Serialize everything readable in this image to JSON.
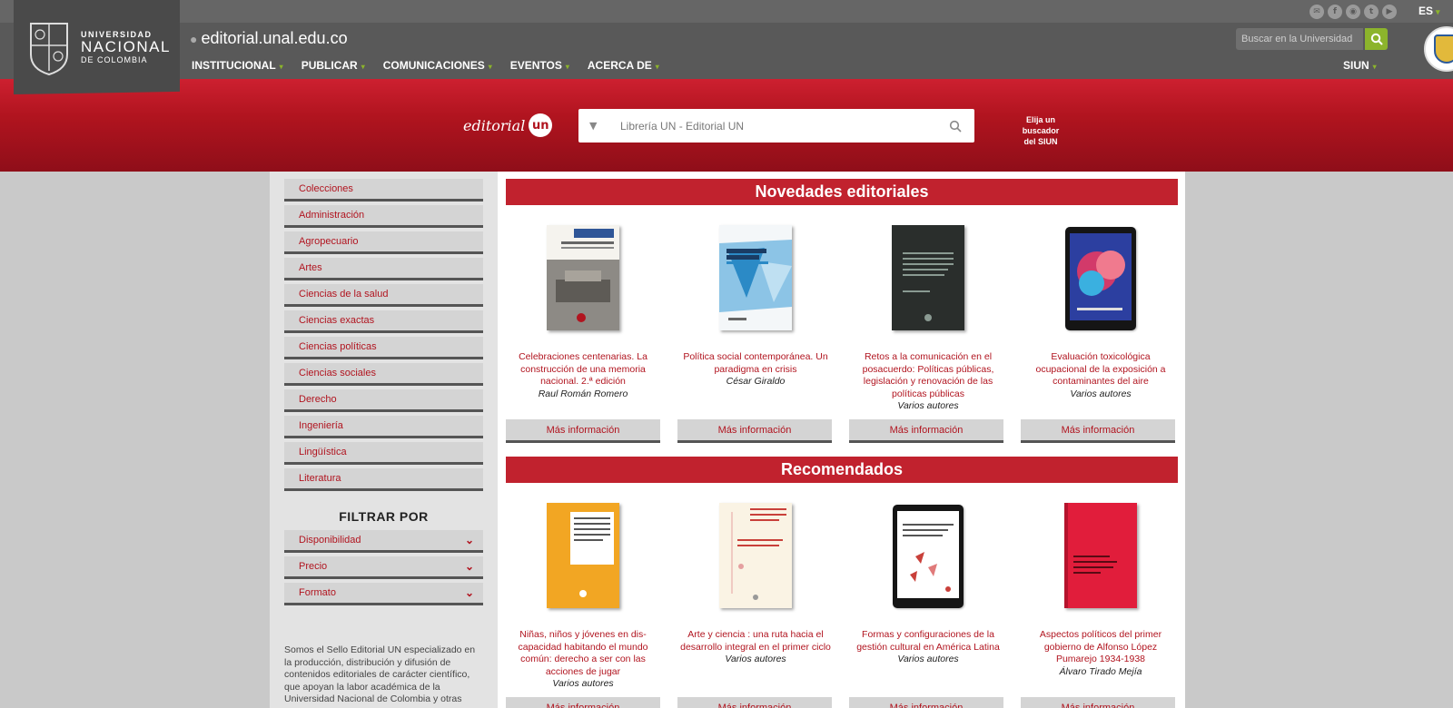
{
  "header": {
    "logo": {
      "line1": "UNIVERSIDAD",
      "line2": "NACIONAL",
      "line3": "DE COLOMBIA"
    },
    "site_url": "editorial.unal.edu.co",
    "nav": [
      "INSTITUCIONAL",
      "PUBLICAR",
      "COMUNICACIONES",
      "EVENTOS",
      "ACERCA DE"
    ],
    "siun": "SIUN",
    "language": "ES",
    "search_placeholder": "Buscar en la Universidad",
    "social_icons": [
      "email-icon",
      "facebook-icon",
      "rss-icon",
      "twitter-icon",
      "youtube-icon"
    ],
    "accent_color": "#8cb42c"
  },
  "banner": {
    "editorial_word": "editorial",
    "editorial_badge": "un",
    "search_text": "Librería UN - Editorial UN",
    "elija_line1": "Elija un buscador",
    "elija_line2": "del SIUN",
    "brand_color": "#b1141f"
  },
  "sidebar": {
    "categories": [
      "Colecciones",
      "Administración",
      "Agropecuario",
      "Artes",
      "Ciencias de la salud",
      "Ciencias exactas",
      "Ciencias políticas",
      "Ciencias sociales",
      "Derecho",
      "Ingeniería",
      "Lingüística",
      "Literatura"
    ],
    "filter_title": "FILTRAR POR",
    "filters": [
      "Disponibilidad",
      "Precio",
      "Formato"
    ],
    "about": "Somos el Sello Editorial UN especializado en la producción, distribución y difusión de contenidos editoriales de carácter científico, que apoyan la labor académica de la Universidad Nacional de Colombia y otras"
  },
  "sections": [
    {
      "title": "Novedades editoriales",
      "books": [
        {
          "title": "Celebraciones centenarias. La construcción de una memoria nacional. 2.ª edición",
          "author": "Raul Román Romero",
          "button": "Más información"
        },
        {
          "title": "Política social contemporánea. Un paradigma en crisis",
          "author": "César Giraldo",
          "button": "Más información"
        },
        {
          "title": "Retos a la comunicación en el posacuerdo: Políticas públicas, legislación y renovación de las políticas públicas",
          "author": "Varios autores",
          "button": "Más información"
        },
        {
          "title": "Evaluación toxicológica ocupacional de la exposición a contaminantes del aire",
          "author": "Varios autores",
          "button": "Más información"
        }
      ]
    },
    {
      "title": "Recomendados",
      "books": [
        {
          "title": "Niñas, niños y jóvenes en dis-capacidad habitando el mundo común: derecho a ser con las acciones de jugar",
          "author": "Varios autores",
          "button": "Más información"
        },
        {
          "title": "Arte y ciencia : una ruta hacia el desarrollo integral en el primer ciclo",
          "author": "Varios autores",
          "button": "Más información"
        },
        {
          "title": "Formas y configuraciones de la gestión cultural en América Latina",
          "author": "Varios autores",
          "button": "Más información"
        },
        {
          "title": "Aspectos políticos del primer gobierno de Alfonso López Pumarejo 1934-1938",
          "author": "Álvaro Tirado Mejía",
          "button": "Más información"
        }
      ]
    }
  ]
}
